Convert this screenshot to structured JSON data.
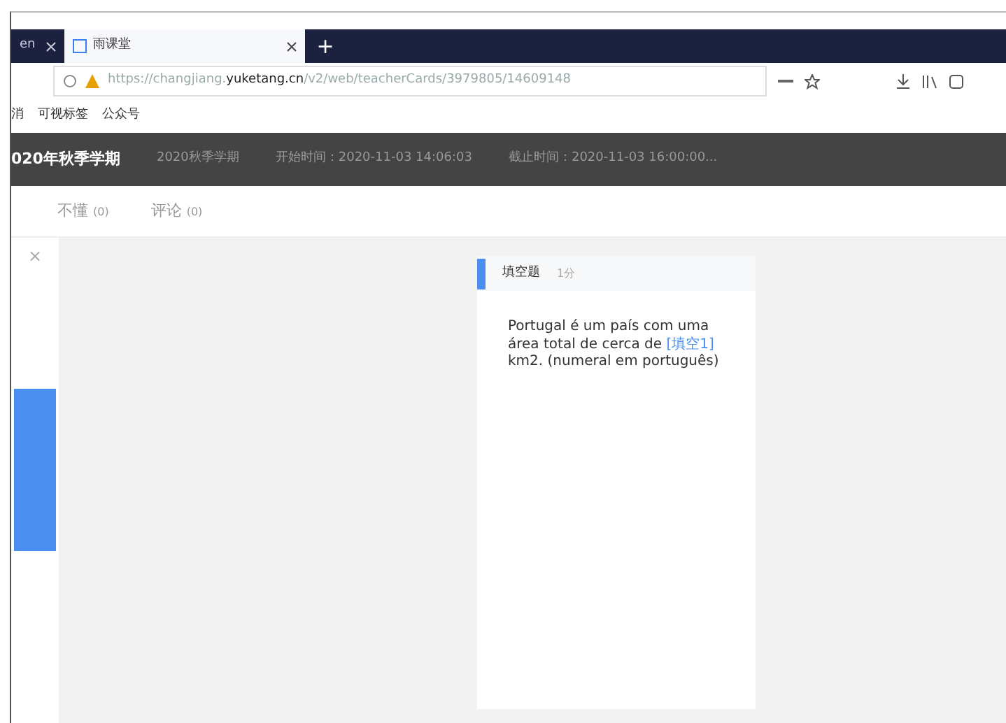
{
  "browser": {
    "tabs": [
      {
        "title": "en",
        "selected": false
      },
      {
        "title": "雨课堂",
        "selected": true
      }
    ],
    "new_tab": "+",
    "url_host_prefix": "https://changjiang.",
    "url_host": "yuketang.cn",
    "url_path": "/v2/web/teacherCards/3979805/14609148",
    "bookmarks": [
      "消",
      "可视标签",
      "公众号"
    ]
  },
  "header": {
    "title": "020年秋季学期",
    "items": [
      "2020秋季学期",
      "开始时间：2020-11-03 14:06:03",
      "截止时间：2020-11-03 16:00:00..."
    ]
  },
  "subtabs": [
    {
      "label": "不懂",
      "count": "(0)",
      "selected": false
    },
    {
      "label": "评论",
      "count": "(0)",
      "selected": false
    }
  ],
  "side_close": "×",
  "card": {
    "type": "填空题",
    "score": "1分",
    "text_before": "Portugal é um país com uma área total de cerca de ",
    "blank": "[填空1]",
    "text_after": " km2. (numeral em português)"
  }
}
